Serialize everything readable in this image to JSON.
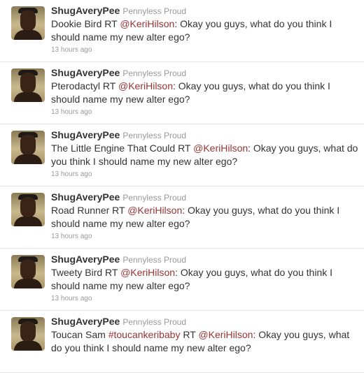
{
  "tweets": [
    {
      "username": "ShugAveryPee",
      "fullname": "Pennyless Proud",
      "prefix": "Dookie Bird RT ",
      "hashtag": "",
      "mid": "",
      "mention": "@KeriHilson",
      "body": ": Okay you guys, what do you think I should name my new alter ego?",
      "time": "13 hours ago"
    },
    {
      "username": "ShugAveryPee",
      "fullname": "Pennyless Proud",
      "prefix": "Pterodactyl RT ",
      "hashtag": "",
      "mid": "",
      "mention": "@KeriHilson",
      "body": ": Okay you guys, what do you think I should name my new alter ego?",
      "time": "13 hours ago"
    },
    {
      "username": "ShugAveryPee",
      "fullname": "Pennyless Proud",
      "prefix": "The Little Engine That Could RT ",
      "hashtag": "",
      "mid": "",
      "mention": "@KeriHilson",
      "body": ": Okay you guys, what do you think I should name my new alter ego?",
      "time": "13 hours ago"
    },
    {
      "username": "ShugAveryPee",
      "fullname": "Pennyless Proud",
      "prefix": "Road Runner RT ",
      "hashtag": "",
      "mid": "",
      "mention": "@KeriHilson",
      "body": ": Okay you guys, what do you think I should name my new alter ego?",
      "time": "13 hours ago"
    },
    {
      "username": "ShugAveryPee",
      "fullname": "Pennyless Proud",
      "prefix": "Tweety Bird RT ",
      "hashtag": "",
      "mid": "",
      "mention": "@KeriHilson",
      "body": ": Okay you guys, what do you think I should name my new alter ego?",
      "time": "13 hours ago"
    },
    {
      "username": "ShugAveryPee",
      "fullname": "Pennyless Proud",
      "prefix": "Toucan Sam ",
      "hashtag": "#toucankeribaby",
      "mid": " RT ",
      "mention": "@KeriHilson",
      "body": ": Okay you guys, what do you think I should name my new alter ego?",
      "time": ""
    }
  ],
  "colors": {
    "link": "#993333",
    "username": "#333333",
    "meta": "#999999"
  }
}
